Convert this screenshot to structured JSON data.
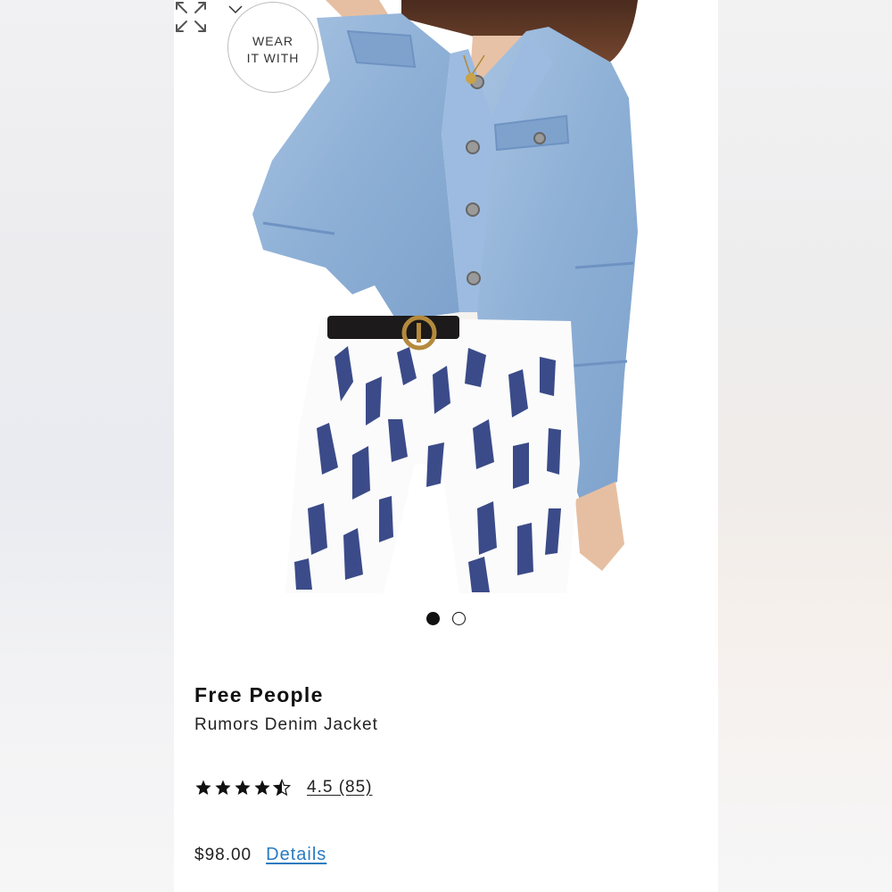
{
  "wear_badge": {
    "line1": "WEAR",
    "line2": "IT WITH",
    "icon": "chevron-down-icon"
  },
  "gallery": {
    "total_images": 2,
    "active_index": 0,
    "expand_icon": "expand-arrows-icon"
  },
  "product": {
    "brand": "Free People",
    "name": "Rumors Denim Jacket",
    "rating_text": "4.5 (85)",
    "rating_value": 4.5,
    "price": "$98.00",
    "details_label": "Details"
  },
  "colors": {
    "link": "#2a7ac0",
    "text": "#222222",
    "denim": "#8fb0d6",
    "print_navy": "#2b3d80"
  }
}
